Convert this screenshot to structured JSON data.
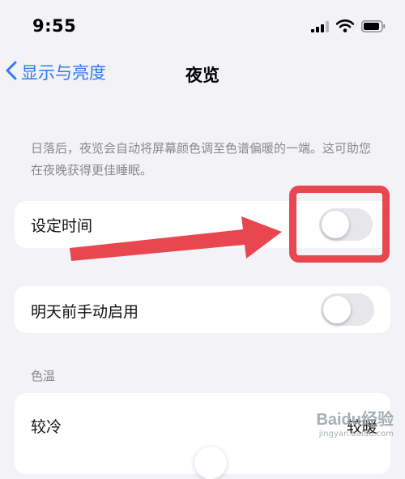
{
  "status_bar": {
    "time": "9:55"
  },
  "nav": {
    "back_label": "显示与亮度",
    "title": "夜览"
  },
  "description": "日落后，夜览会自动将屏幕颜色调至色谱偏暖的一端。这可助您在夜晚获得更佳睡眠。",
  "settings": {
    "scheduled": {
      "label": "设定时间",
      "enabled": false
    },
    "manual": {
      "label": "明天前手动启用",
      "enabled": false
    }
  },
  "color_temp": {
    "header": "色温",
    "cooler_label": "较冷",
    "warmer_label": "较暖"
  },
  "annotation": {
    "color": "#e8474f"
  },
  "watermark": {
    "logo": "Baidu经验",
    "url": "jingyan.baidu.com"
  },
  "colors": {
    "accent": "#2f7cf6",
    "background": "#f2f2f7",
    "switch_off": "#e6e6eb"
  }
}
